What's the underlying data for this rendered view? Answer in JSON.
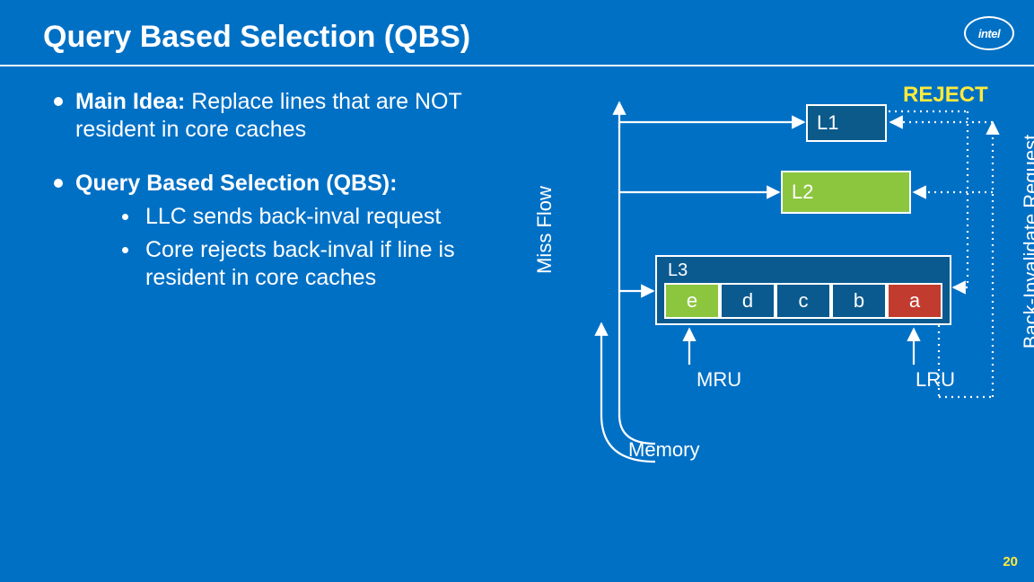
{
  "title": "Query Based Selection (QBS)",
  "logo_text": "intel",
  "bullets": {
    "b1_bold": "Main Idea:",
    "b1_rest": " Replace lines that are NOT resident in core caches",
    "b2": "Query Based Selection (QBS):",
    "sub1": "LLC sends back-inval request",
    "sub2": "Core rejects back-inval if line is resident in core caches"
  },
  "diagram": {
    "miss_flow": "Miss Flow",
    "back_inval": "Back-Invalidate Request",
    "reject": "REJECT",
    "L1": "L1",
    "L2": "L2",
    "L3": "L3",
    "cells": [
      "e",
      "d",
      "c",
      "b",
      "a"
    ],
    "mru": "MRU",
    "lru": "LRU",
    "memory": "Memory"
  },
  "page_number": "20"
}
